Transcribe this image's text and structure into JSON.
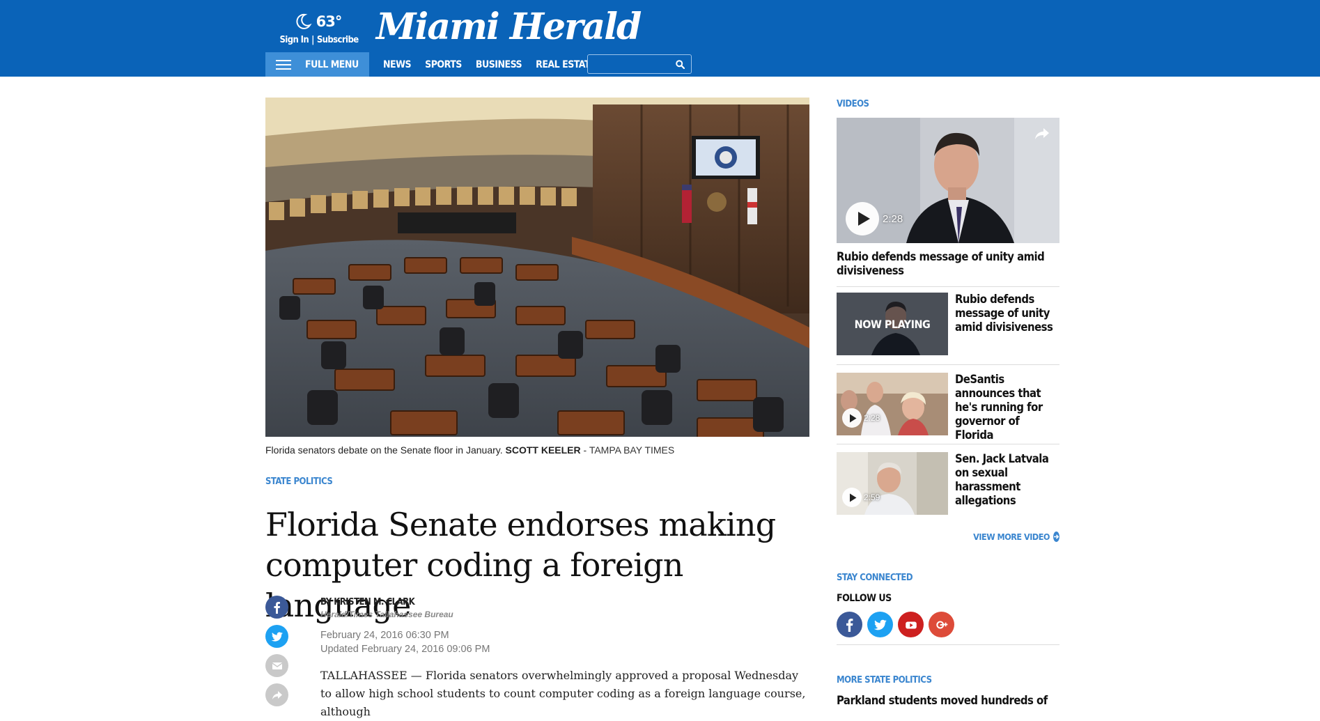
{
  "header": {
    "temperature": "63°",
    "sign_in": "Sign In",
    "separator": "|",
    "subscribe": "Subscribe",
    "logo_text": "Miami Herald",
    "full_menu": "FULL MENU",
    "nav": [
      "NEWS",
      "SPORTS",
      "BUSINESS",
      "REAL ESTATE"
    ],
    "search_value": "",
    "brand_color": "#0a63b8"
  },
  "article": {
    "caption": "Florida senators debate on the Senate floor in January.",
    "photo_credit_name": "SCOTT KEELER",
    "photo_credit_org": " - TAMPA BAY TIMES",
    "section": "STATE POLITICS",
    "headline": "Florida Senate endorses making computer coding a foreign language",
    "author": "BY KRISTEN M. CLARK",
    "bureau": "Herald/Times Tallahassee Bureau",
    "published": "February 24, 2016 06:30 PM",
    "updated": "Updated February 24, 2016 09:06 PM",
    "body": "TALLAHASSEE — Florida senators overwhelmingly approved a proposal Wednesday to allow high school students to count computer coding as a foreign language course, although",
    "share_icons": [
      "facebook-icon",
      "twitter-icon",
      "email-icon",
      "share-icon"
    ]
  },
  "sidebar": {
    "videos_label": "VIDEOS",
    "lead_video": {
      "duration": "2:28",
      "title": "Rubio defends message of unity amid divisiveness"
    },
    "videos": [
      {
        "title": "Rubio defends message of unity amid divisiveness",
        "overlay": "NOW PLAYING",
        "duration": ""
      },
      {
        "title": "DeSantis announces that he's running for governor of Florida",
        "overlay": "",
        "duration": "2:28"
      },
      {
        "title": "Sen. Jack Latvala on sexual harassment allegations",
        "overlay": "",
        "duration": "2:59"
      }
    ],
    "view_more": "VIEW MORE VIDEO",
    "stay_connected": "STAY CONNECTED",
    "follow_us": "FOLLOW US",
    "social_icons": [
      "facebook-icon",
      "twitter-icon",
      "youtube-icon",
      "google-plus-icon"
    ],
    "more_label": "MORE STATE POLITICS",
    "more_title": "Parkland students moved hundreds of"
  }
}
